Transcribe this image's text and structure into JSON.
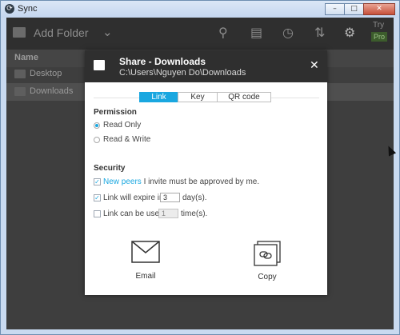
{
  "window": {
    "title": "Sync",
    "min_label": "–",
    "max_label": "□",
    "close_label": "✕"
  },
  "toolbar": {
    "add_folder": "Add Folder",
    "try": "Try",
    "pro": "Pro"
  },
  "list": {
    "header": "Name",
    "rows": [
      {
        "name": "Desktop"
      },
      {
        "name": "Downloads"
      }
    ]
  },
  "dialog": {
    "title": "Share - Downloads",
    "path": "C:\\Users\\Nguyen Do\\Downloads",
    "tabs": [
      {
        "label": "Link"
      },
      {
        "label": "Key"
      },
      {
        "label": "QR code"
      }
    ],
    "active_tab": "Link",
    "permission": {
      "title": "Permission",
      "options": [
        {
          "label": "Read Only",
          "selected": true
        },
        {
          "label": "Read & Write",
          "selected": false
        }
      ]
    },
    "security": {
      "title": "Security",
      "new_peers_link": "New peers",
      "new_peers_rest": " I invite must be approved by me.",
      "expire_label": "Link will expire in:",
      "expire_value": "3",
      "expire_unit": "day(s).",
      "used_label": "Link can be used:",
      "used_value": "1",
      "used_unit": "time(s)."
    },
    "actions": {
      "email": "Email",
      "copy": "Copy"
    }
  }
}
